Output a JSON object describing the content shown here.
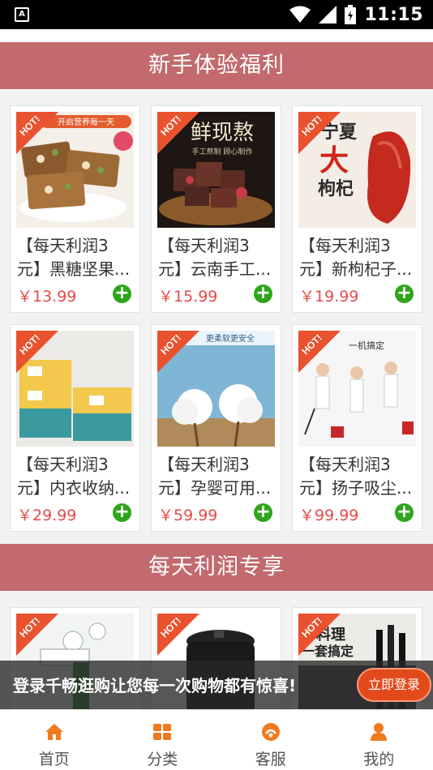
{
  "status_bar": {
    "time": "11:15"
  },
  "sections": [
    {
      "title": "新手体验福利"
    },
    {
      "title": "每天利润专享"
    }
  ],
  "products": [
    {
      "line1": "【每天利润3",
      "line2": "元】黑糖坚果...",
      "price": "￥13.99",
      "badge": "HOT!"
    },
    {
      "line1": "【每天利润3",
      "line2": "元】云南手工...",
      "price": "￥15.99",
      "badge": "HOT!"
    },
    {
      "line1": "【每天利润3",
      "line2": "元】新枸杞子...",
      "price": "￥19.99",
      "badge": "HOT!"
    },
    {
      "line1": "【每天利润3",
      "line2": "元】内衣收纳...",
      "price": "￥29.99",
      "badge": "HOT!"
    },
    {
      "line1": "【每天利润3",
      "line2": "元】孕婴可用...",
      "price": "￥59.99",
      "badge": "HOT!"
    },
    {
      "line1": "【每天利润3",
      "line2": "元】扬子吸尘...",
      "price": "￥99.99",
      "badge": "HOT!"
    }
  ],
  "products2": [
    {
      "badge": "HOT!"
    },
    {
      "badge": "HOT!"
    },
    {
      "badge": "HOT!"
    }
  ],
  "image_text": {
    "p1": "开启营养每一天",
    "p2": "鲜现熬",
    "p2sub": "手工熬制 顾心制作",
    "p3a": "宁夏",
    "p3b": "大",
    "p3c": "枸杞",
    "p5": "更柔软更安全",
    "p6": "一机搞定",
    "q3a": "好料理",
    "q3b": "一套搞定"
  },
  "login_prompt": {
    "text": "登录千畅逛购让您每一次购物都有惊喜!",
    "button": "立即登录"
  },
  "tabs": [
    {
      "label": "首页",
      "icon": "home-icon"
    },
    {
      "label": "分类",
      "icon": "grid-icon"
    },
    {
      "label": "客服",
      "icon": "service-icon"
    },
    {
      "label": "我的",
      "icon": "user-icon"
    }
  ],
  "colors": {
    "banner": "#c26a6d",
    "price": "#e84a4a",
    "add": "#2fa51c",
    "accent": "#f07a1e",
    "hot": "#e8522e"
  }
}
